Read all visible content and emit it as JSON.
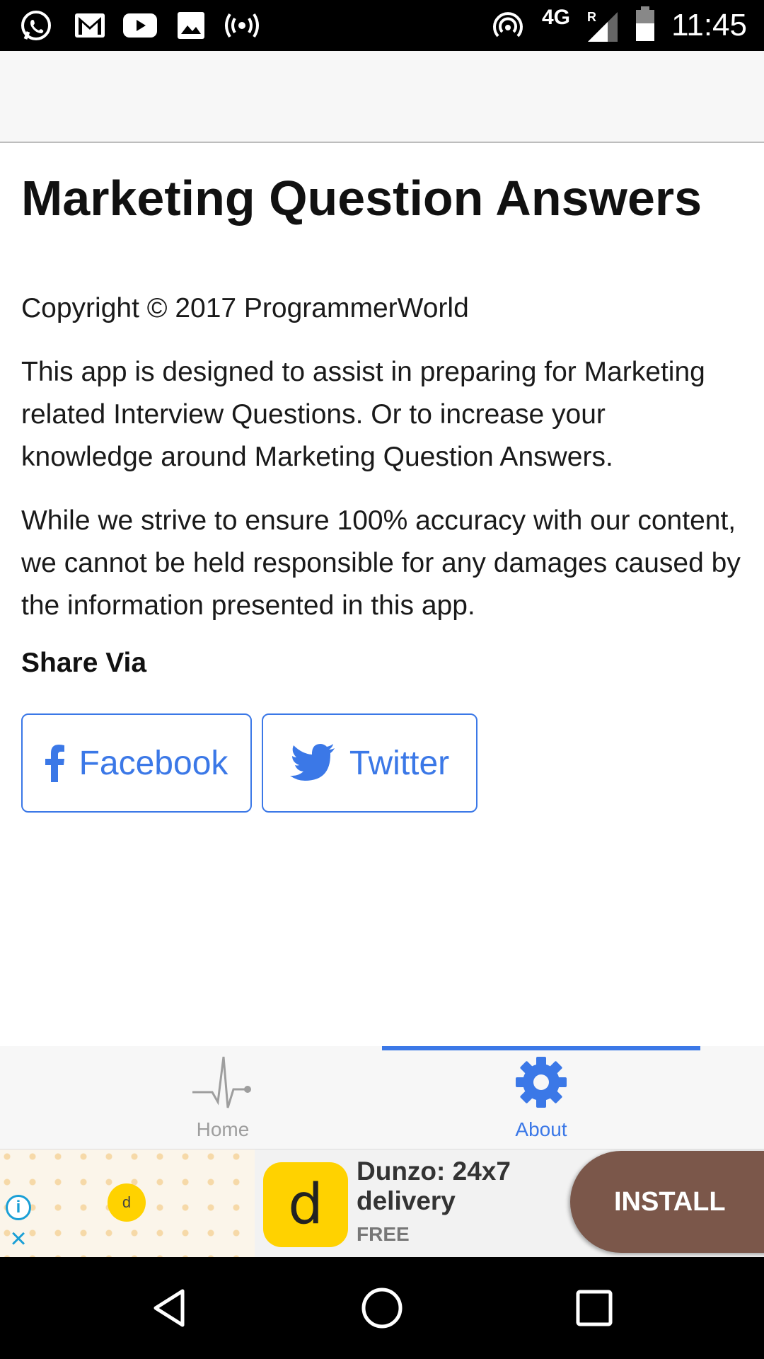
{
  "status_bar": {
    "time": "11:45",
    "network": "4G",
    "roaming": "R",
    "left_icons": [
      "whatsapp-icon",
      "gmail-icon",
      "youtube-icon",
      "gallery-icon",
      "hotspot-icon"
    ],
    "right_icons": [
      "wireless-icon",
      "signal-icon",
      "battery-icon"
    ]
  },
  "content": {
    "title": "Marketing Question Answers",
    "copyright": "Copyright © 2017 ProgrammerWorld",
    "paragraph1": "This app is designed to assist in preparing for Marketing related Interview Questions. Or to increase your knowledge around Marketing Question Answers.",
    "paragraph2": "While we strive to ensure 100% accuracy with our content, we cannot be held responsible for any damages caused by the information presented in this app.",
    "share_label": "Share Via",
    "facebook_label": "Facebook",
    "twitter_label": "Twitter"
  },
  "tabs": {
    "home_label": "Home",
    "about_label": "About",
    "active": "About"
  },
  "ad": {
    "small_logo_letter": "d",
    "logo_letter": "d",
    "title": "Dunzo: 24x7 delivery",
    "price": "FREE",
    "install_label": "INSTALL",
    "info_glyph": "i",
    "close_glyph": "×"
  },
  "colors": {
    "accent": "#3b78e7",
    "install_button": "#7b574a",
    "ad_logo": "#ffd200"
  }
}
